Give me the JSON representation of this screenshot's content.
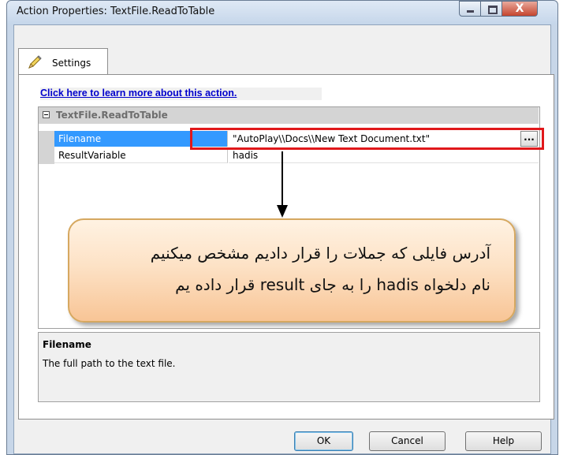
{
  "window": {
    "title": "Action Properties: TextFile.ReadToTable",
    "close_symbol": "X"
  },
  "tab": {
    "label": "Settings",
    "icon": "pencil-icon"
  },
  "learn_link": "Click here to learn more about this action.",
  "properties": {
    "category": "TextFile.ReadToTable",
    "rows": [
      {
        "name": "Filename",
        "value": "\"AutoPlay\\\\Docs\\\\New Text Document.txt\""
      },
      {
        "name": "ResultVariable",
        "value": "hadis"
      }
    ],
    "browse_label": "..."
  },
  "annotation": {
    "line1": "آدرس فایلی که جملات را قرار دادیم مشخص میکنیم",
    "line2": "نام دلخواه  hadis را به جای result قرار داده یم",
    "highlight_color": "#e0181b"
  },
  "description": {
    "title": "Filename",
    "text": "The full path to the text file."
  },
  "buttons": {
    "ok": "OK",
    "cancel": "Cancel",
    "help": "Help"
  }
}
